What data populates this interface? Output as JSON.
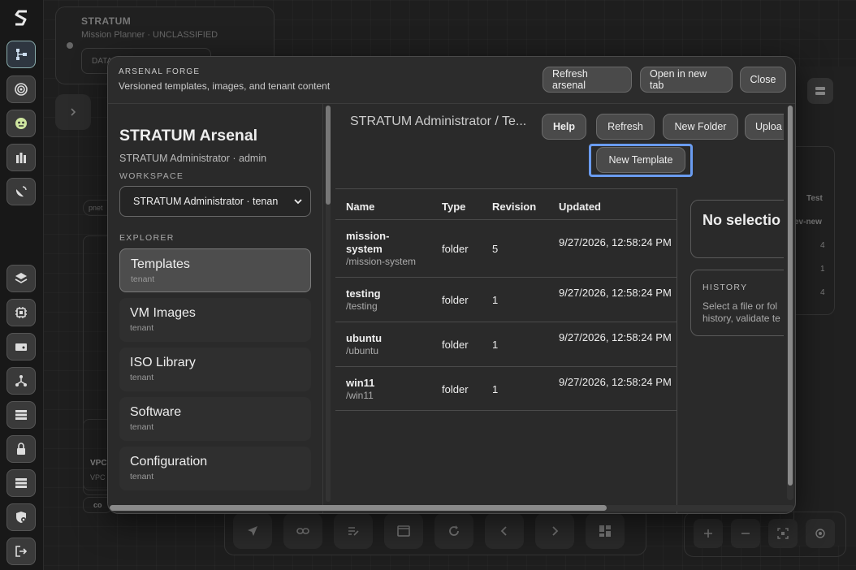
{
  "background": {
    "card_title": "STRATUM",
    "card_subtitle": "Mission Planner · UNCLASSIFIED",
    "card_field": "DATA",
    "right_table": {
      "header": "Test",
      "row_label": "ev-new",
      "values": [
        "4",
        "1",
        "4"
      ]
    },
    "frag_pnet": "pnet",
    "frag_vpc": "VPC",
    "frag_vpc2": "VPC",
    "frag_co": "co"
  },
  "modal": {
    "eyebrow": "ARSENAL FORGE",
    "subtitle": "Versioned templates, images, and tenant content",
    "header_buttons": {
      "refresh_arsenal": "Refresh arsenal",
      "open_new_tab": "Open in new tab",
      "close": "Close"
    },
    "sidebar": {
      "title": "STRATUM Arsenal",
      "user": "STRATUM Administrator · admin",
      "workspace_label": "WORKSPACE",
      "workspace_value": "STRATUM Administrator · tenan",
      "explorer_label": "EXPLORER",
      "items": [
        {
          "name": "Templates",
          "scope": "tenant"
        },
        {
          "name": "VM Images",
          "scope": "tenant"
        },
        {
          "name": "ISO Library",
          "scope": "tenant"
        },
        {
          "name": "Software",
          "scope": "tenant"
        },
        {
          "name": "Configuration",
          "scope": "tenant"
        }
      ]
    },
    "content": {
      "breadcrumb": "STRATUM Administrator / Te...",
      "buttons": {
        "help": "Help",
        "refresh": "Refresh",
        "new_folder": "New Folder",
        "upload": "Uploa",
        "new_template": "New Template"
      },
      "table": {
        "headers": {
          "name": "Name",
          "type": "Type",
          "revision": "Revision",
          "updated": "Updated"
        },
        "rows": [
          {
            "name": "mission-system",
            "path": "/mission-system",
            "type": "folder",
            "revision": "5",
            "updated": "9/27/2026, 12:58:24 PM"
          },
          {
            "name": "testing",
            "path": "/testing",
            "type": "folder",
            "revision": "1",
            "updated": "9/27/2026, 12:58:24 PM"
          },
          {
            "name": "ubuntu",
            "path": "/ubuntu",
            "type": "folder",
            "revision": "1",
            "updated": "9/27/2026, 12:58:24 PM"
          },
          {
            "name": "win11",
            "path": "/win11",
            "type": "folder",
            "revision": "1",
            "updated": "9/27/2026, 12:58:24 PM"
          }
        ]
      },
      "detail": {
        "no_selection": "No selectio",
        "history_label": "HISTORY",
        "history_text": "Select a file or fol history, validate te"
      }
    }
  }
}
